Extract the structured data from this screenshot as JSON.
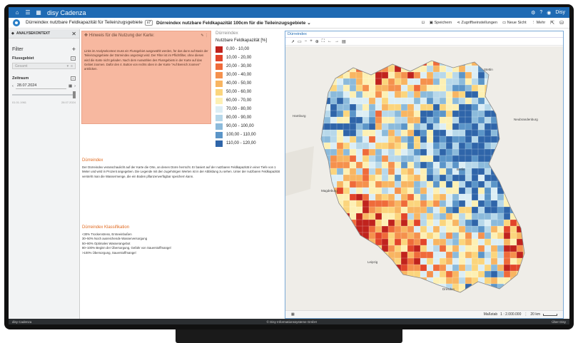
{
  "appbar": {
    "brand": "disy Cadenza",
    "user": "Disy"
  },
  "titlebar": {
    "workbook_title": "Dürreindex nutzbare Feldkapazität für Teileinzugsgebiete",
    "badge": "x7",
    "view_title": "Dürreindex nutzbare Feldkapazität 100cm für die Teileinzugsgebiete",
    "actions": {
      "save": "Speichern",
      "access": "Zugriffseinstellungen",
      "new_view": "Neue Sicht",
      "more": "Mehr"
    }
  },
  "leftpanel": {
    "header": "ANALYSEKONTEXT",
    "filter_title": "Filter",
    "catchment_label": "Flussgebiet",
    "catchment_placeholder": "Gesamt",
    "period_label": "Zeitraum",
    "date_value": "28.07.2024",
    "range_start": "01.01.1961",
    "range_end": "28.07.2024"
  },
  "hint": {
    "title": "Hinweis für die Nutzung der Karte:",
    "body": "Links im Analysekontext muss ein Flussgebiet ausgewählt werden, für das dann auf Basis der Teileinzugsgebiete der Dürreindex angezeigt wird. Der Filter ist im Pflichtfilter, ohne diesen wird die Karte nicht geladen. Nach dem Auswählen des Flussgebiets in der Karte auf das Gebiet zoomen. Dafür den 4. Button von rechts oben in der Karte \"Auf Bereich zoomen\" anklicken."
  },
  "legend": {
    "title": "Dürreindex",
    "subtitle": "Nutzbare Feldkapazität [%]",
    "classes": [
      {
        "label": "0,00 - 10,00",
        "color": "#c0231d"
      },
      {
        "label": "10,00 - 20,00",
        "color": "#e2452a"
      },
      {
        "label": "20,00 - 30,00",
        "color": "#ef6b3a"
      },
      {
        "label": "30,00 - 40,00",
        "color": "#f5914d"
      },
      {
        "label": "40,00 - 50,00",
        "color": "#f8b562"
      },
      {
        "label": "50,00 - 60,00",
        "color": "#fbd57d"
      },
      {
        "label": "60,00 - 70,00",
        "color": "#fdf0b4"
      },
      {
        "label": "70,00 - 80,00",
        "color": "#dceef5"
      },
      {
        "label": "80,00 - 90,00",
        "color": "#b7d8ea"
      },
      {
        "label": "90,00 - 100,00",
        "color": "#8bbadb"
      },
      {
        "label": "100,00 - 110,00",
        "color": "#5b95c8"
      },
      {
        "label": "110,00 - 120,00",
        "color": "#2f65a9"
      }
    ]
  },
  "description": {
    "title": "Dürreindex",
    "body": "Der Dürreindex veranschaulicht auf der Karte die Orte, an denen Dürre herrscht. Er basiert auf der nutzbaren Feldkapazität in einer Tiefe von 1 Meter und wird in Prozent angegeben. Die Legende mit den zugehörigen Werten ist in der Abbildung zu sehen. Unter der nutzbaren Feldkapazität versteht man die Wassermenge, die ein Boden pflanzenverfügbar speichern kann."
  },
  "classification": {
    "title": "Dürreindex Klassifikation",
    "items": [
      "<30% Trockenstress, Ernteeinbußen",
      "30–50% Noch ausreichende Wasserversorgung",
      "50–80% Optimales Wasserangebot",
      "80–100% Beginn der Übersorgung, Gefahr von Sauerstoffmangel",
      ">100% Übersorgung, Sauerstoffmangel"
    ]
  },
  "map": {
    "title": "Dürreindex",
    "scale_label": "Maßstab",
    "scale_value": "1 : 2.000.000",
    "scale_bar": "20 km",
    "cities": {
      "c1": "Stettin",
      "c2": "Neubrandenburg",
      "c3": "Hamburg",
      "c4": "Magdeburg",
      "c5": "Berlin",
      "c6": "Leipzig",
      "c7": "Dresden"
    }
  },
  "statusbar": {
    "left": "disy Cadenza",
    "center": "© Disy Informationssysteme GmbH",
    "right": "Über Disy"
  }
}
